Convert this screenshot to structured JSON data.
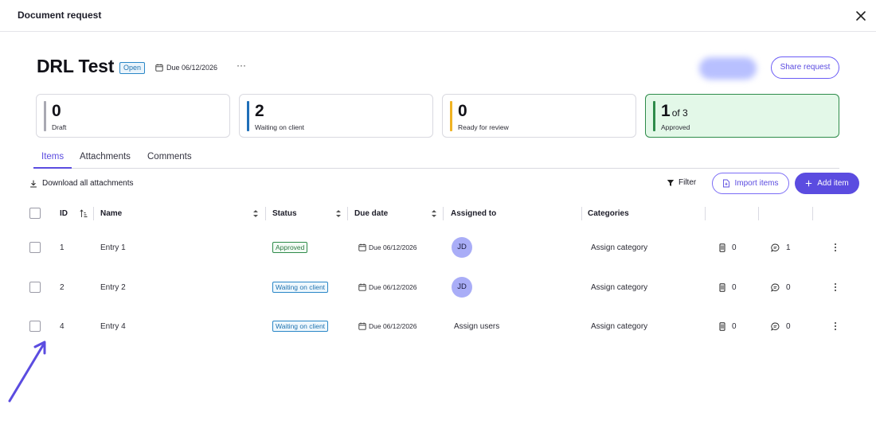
{
  "header": {
    "title": "Document request"
  },
  "request": {
    "title": "DRL Test",
    "status": "Open",
    "due": "Due 06/12/2026",
    "more": "···",
    "share_label": "Share request"
  },
  "stats": [
    {
      "value": "0",
      "label": "Draft",
      "color": "#a9a9b3"
    },
    {
      "value": "2",
      "label": "Waiting on client",
      "color": "#1f6fb8"
    },
    {
      "value": "0",
      "label": "Ready for review",
      "color": "#f0b323"
    },
    {
      "value": "1",
      "suffix": "of 3",
      "label": "Approved",
      "color": "#2e8b4a"
    }
  ],
  "tabs": [
    {
      "label": "Items",
      "active": true
    },
    {
      "label": "Attachments",
      "active": false
    },
    {
      "label": "Comments",
      "active": false
    }
  ],
  "toolbar": {
    "download_label": "Download all attachments",
    "filter_label": "Filter",
    "import_label": "Import items",
    "add_label": "Add item"
  },
  "table": {
    "columns": {
      "id": "ID",
      "name": "Name",
      "status": "Status",
      "due_date": "Due date",
      "assigned_to": "Assigned to",
      "categories": "Categories"
    },
    "rows": [
      {
        "id": "1",
        "name": "Entry 1",
        "status": "Approved",
        "status_kind": "approved",
        "due": "Due 06/12/2026",
        "assignee": "JD",
        "assign_users": "",
        "category": "Assign category",
        "attachments": "0",
        "comments": "1"
      },
      {
        "id": "2",
        "name": "Entry 2",
        "status": "Waiting on client",
        "status_kind": "waiting",
        "due": "Due 06/12/2026",
        "assignee": "JD",
        "assign_users": "",
        "category": "Assign category",
        "attachments": "0",
        "comments": "0"
      },
      {
        "id": "4",
        "name": "Entry 4",
        "status": "Waiting on client",
        "status_kind": "waiting",
        "due": "Due 06/12/2026",
        "assignee": "",
        "assign_users": "Assign users",
        "category": "Assign category",
        "attachments": "0",
        "comments": "0"
      }
    ]
  },
  "colors": {
    "accent": "#5b4ce0",
    "approved": "#2e8b4a",
    "waiting": "#2a87c7",
    "avatar": "#a9adf7"
  }
}
